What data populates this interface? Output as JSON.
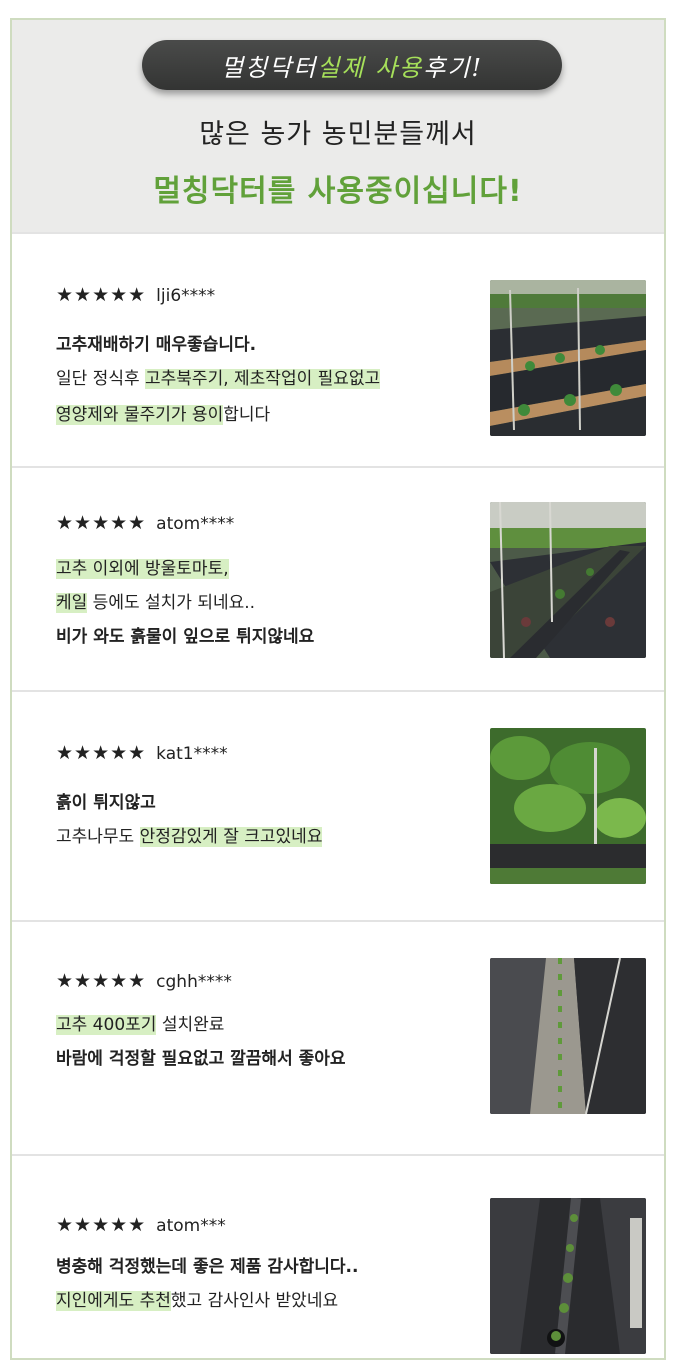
{
  "header": {
    "pill_part1": "멀칭닥터 ",
    "pill_highlight": "실제 사용",
    "pill_part2": " 후기!",
    "subtitle": "많은 농가 농민분들께서",
    "title": "멀칭닥터를 사용중이십니다!"
  },
  "stars": "★★★★★",
  "reviews": [
    {
      "user": "lji6****",
      "lines": [
        [
          {
            "t": "고추재배하기 매우좋습니다.",
            "b": true
          }
        ],
        [
          {
            "t": "일단 정식후 "
          },
          {
            "t": "고추북주기, 제초작업이 필요없고",
            "h": true
          }
        ],
        [
          {
            "t": "영양제와 물주기가 용이",
            "h": true
          },
          {
            "t": "합니다"
          }
        ]
      ],
      "photo_icon": "mulched-field-rows-photo"
    },
    {
      "user": "atom****",
      "lines": [
        [
          {
            "t": "고추 이외에 방울토마토,",
            "h": true
          }
        ],
        [
          {
            "t": "케일",
            "h": true
          },
          {
            "t": " 등에도 설치가 되네요.."
          }
        ],
        [
          {
            "t": "비가 와도 흙물이 잎으로 튀지않네요",
            "b": true
          }
        ]
      ],
      "photo_icon": "greenhouse-mulch-photo"
    },
    {
      "user": "kat1****",
      "lines": [
        [
          {
            "t": "흙이 튀지않고",
            "b": true
          }
        ],
        [
          {
            "t": "고추나무도 "
          },
          {
            "t": "안정감있게 잘 크고있네요",
            "h": true
          }
        ]
      ],
      "photo_icon": "pepper-plants-photo"
    },
    {
      "user": "cghh****",
      "lines": [
        [
          {
            "t": "고추 400포기",
            "h": true
          },
          {
            "t": " 설치완료"
          }
        ],
        [
          {
            "t": "바람에 걱정할 필요없고 깔끔해서 좋아요",
            "b": true
          }
        ]
      ],
      "photo_icon": "mulch-row-seedlings-photo"
    },
    {
      "user": "atom***",
      "lines": [
        [
          {
            "t": "병충해 걱정했는데 좋은 제품 감사합니다..",
            "b": true
          }
        ],
        [
          {
            "t": "지인에게도 추천",
            "h": true
          },
          {
            "t": "했고 감사인사 받았네요"
          }
        ]
      ],
      "photo_icon": "mulch-seedling-holes-photo"
    }
  ]
}
